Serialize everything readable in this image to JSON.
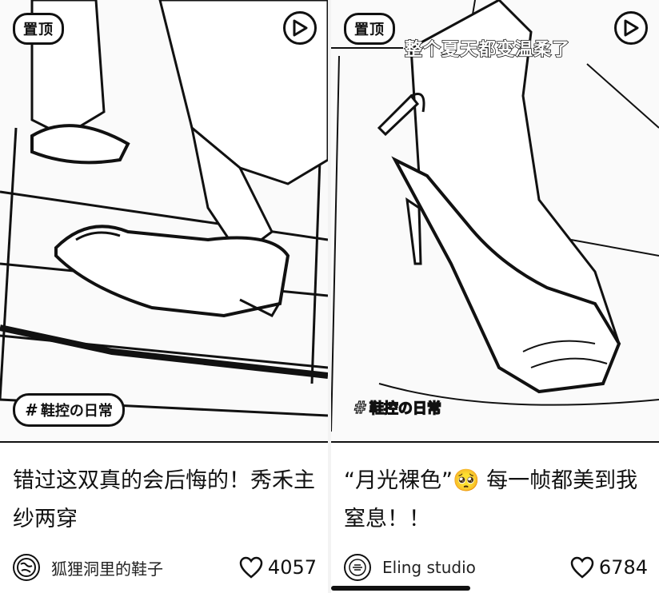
{
  "feed": {
    "cards": [
      {
        "pin_label": "置顶",
        "overlay_caption": "",
        "tag_label": "鞋控の日常",
        "title": "错过这双真的会后悔的！秀禾主纱两穿",
        "author": "狐狸洞里的鞋子",
        "likes": "4057",
        "avatar_icon": "globe-avatar-icon"
      },
      {
        "pin_label": "置顶",
        "overlay_caption": "整个夏天都变温柔了",
        "tag_label": "鞋控の日常",
        "title": "“月光裸色”🥺 每一帧都美到我窒息！！",
        "author": "Eling studio",
        "likes": "6784",
        "avatar_icon": "brand-avatar-icon"
      }
    ]
  },
  "colors": {
    "ink": "#111111",
    "paper": "#ffffff"
  },
  "icons": {
    "play": "play-icon",
    "heart": "heart-icon",
    "hash": "hashtag-icon"
  }
}
